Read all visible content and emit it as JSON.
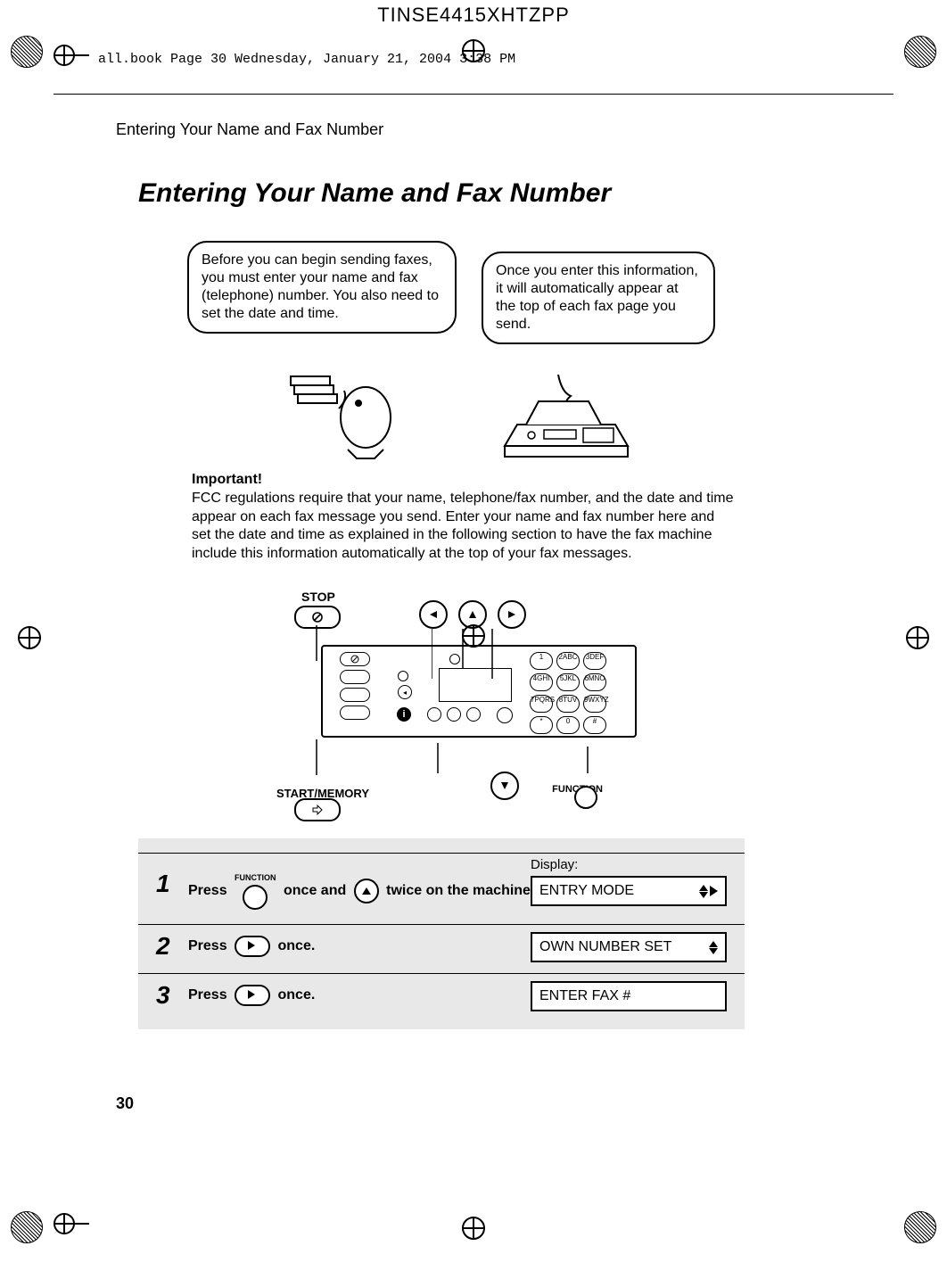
{
  "meta": {
    "top_code": "TINSE4415XHTZPP",
    "print_note": "all.book  Page 30  Wednesday, January 21, 2004  3:38 PM",
    "running_head": "Entering Your Name and Fax Number",
    "page_number": "30"
  },
  "title": "Entering Your Name and Fax Number",
  "speech1": "Before you can begin sending faxes, you must enter your name and fax (telephone) number. You also need to set the date and time.",
  "speech2": "Once you enter this information, it will automatically appear at the top of each fax page you send.",
  "important": {
    "title": "Important!",
    "body": "FCC regulations require that your name, telephone/fax number, and the date and time appear on each fax message you send. Enter your name and fax number here and set the date and time as explained in the following section to have the fax machine include this information automatically at the top of your fax messages."
  },
  "diagram": {
    "labels": {
      "stop": "STOP",
      "start_memory": "START/MEMORY",
      "function": "FUNCTION"
    },
    "keypad": [
      "1",
      "2ABC",
      "3DEF",
      "4GHI",
      "5JKL",
      "6MNO",
      "7PQRS",
      "8TUV",
      "9WXYZ",
      "*",
      "0",
      "#"
    ]
  },
  "steps": [
    {
      "num": "1",
      "pre": "Press ",
      "key1_label": "FUNCTION",
      "mid1": " once and ",
      "mid2": " twice on the machine.",
      "display_caption": "Display:",
      "display_text": "ENTRY MODE",
      "display_arrows": "updown-right"
    },
    {
      "num": "2",
      "pre": "Press ",
      "mid": " once.",
      "display_text": "OWN NUMBER SET",
      "display_arrows": "updown"
    },
    {
      "num": "3",
      "pre": "Press ",
      "mid": " once.",
      "display_text": "ENTER FAX #",
      "display_arrows": "none"
    }
  ]
}
